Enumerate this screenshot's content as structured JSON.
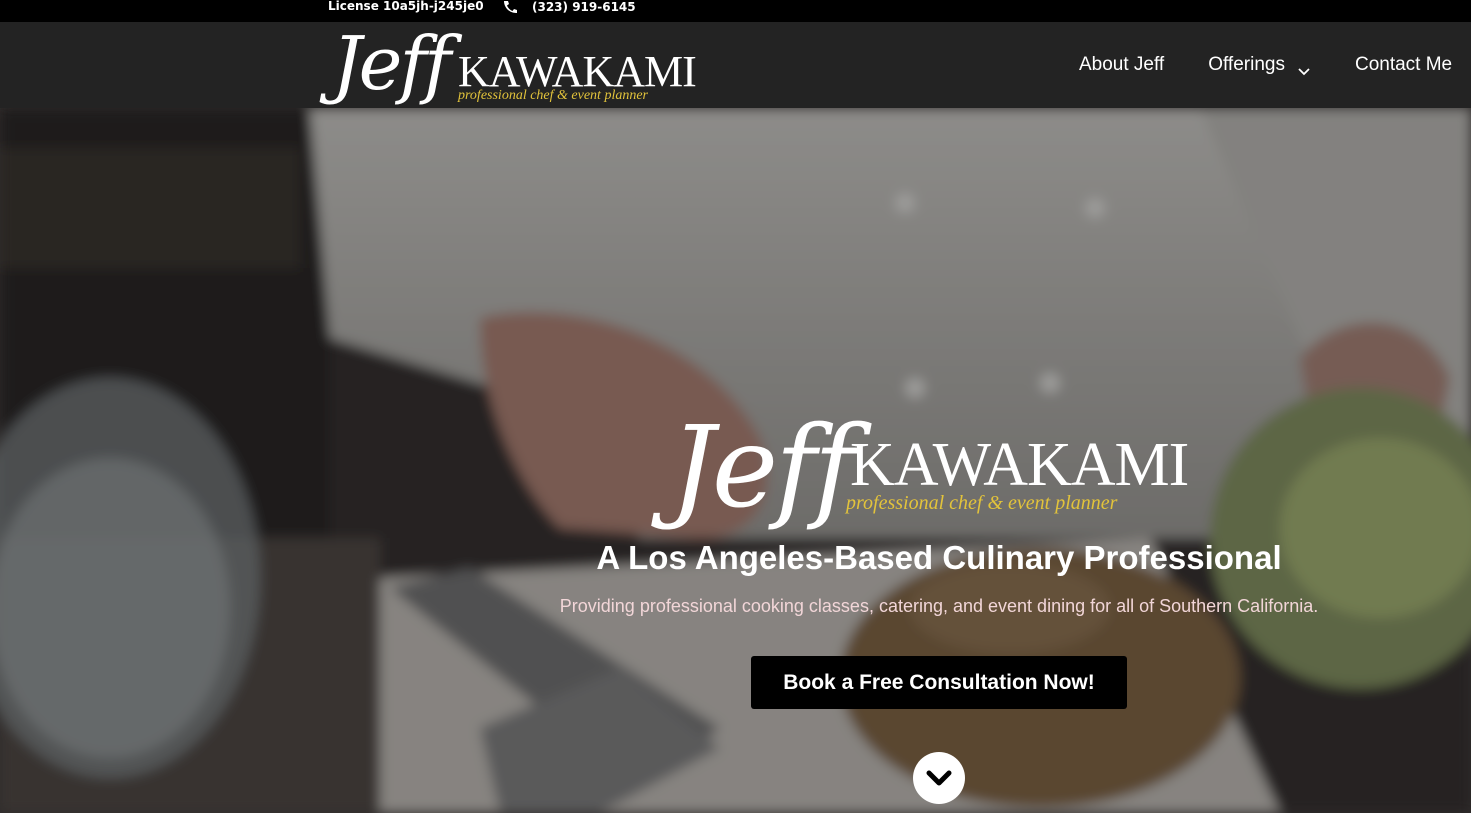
{
  "topbar": {
    "license": "License 10a5jh-j245je0",
    "phone": "(323) 919-6145",
    "phone_icon": "phone-icon"
  },
  "brand": {
    "first": "Jeff",
    "last": "KAWAKAMI",
    "tagline": "professional chef & event planner",
    "tagline_color": "#e2c33b"
  },
  "nav": {
    "items": [
      {
        "label": "About Jeff"
      },
      {
        "label": "Offerings",
        "icon": "chevron-down-icon"
      },
      {
        "label": "Contact Me"
      }
    ]
  },
  "hero": {
    "headline": "A Los Angeles-Based Culinary Professional",
    "subline": "Providing professional cooking classes, catering, and event dining for all of Southern California.",
    "cta_label": "Book a Free Consultation Now!",
    "scroll_icon": "chevron-down-circle-icon",
    "subline_color": "#f2d6d8"
  }
}
